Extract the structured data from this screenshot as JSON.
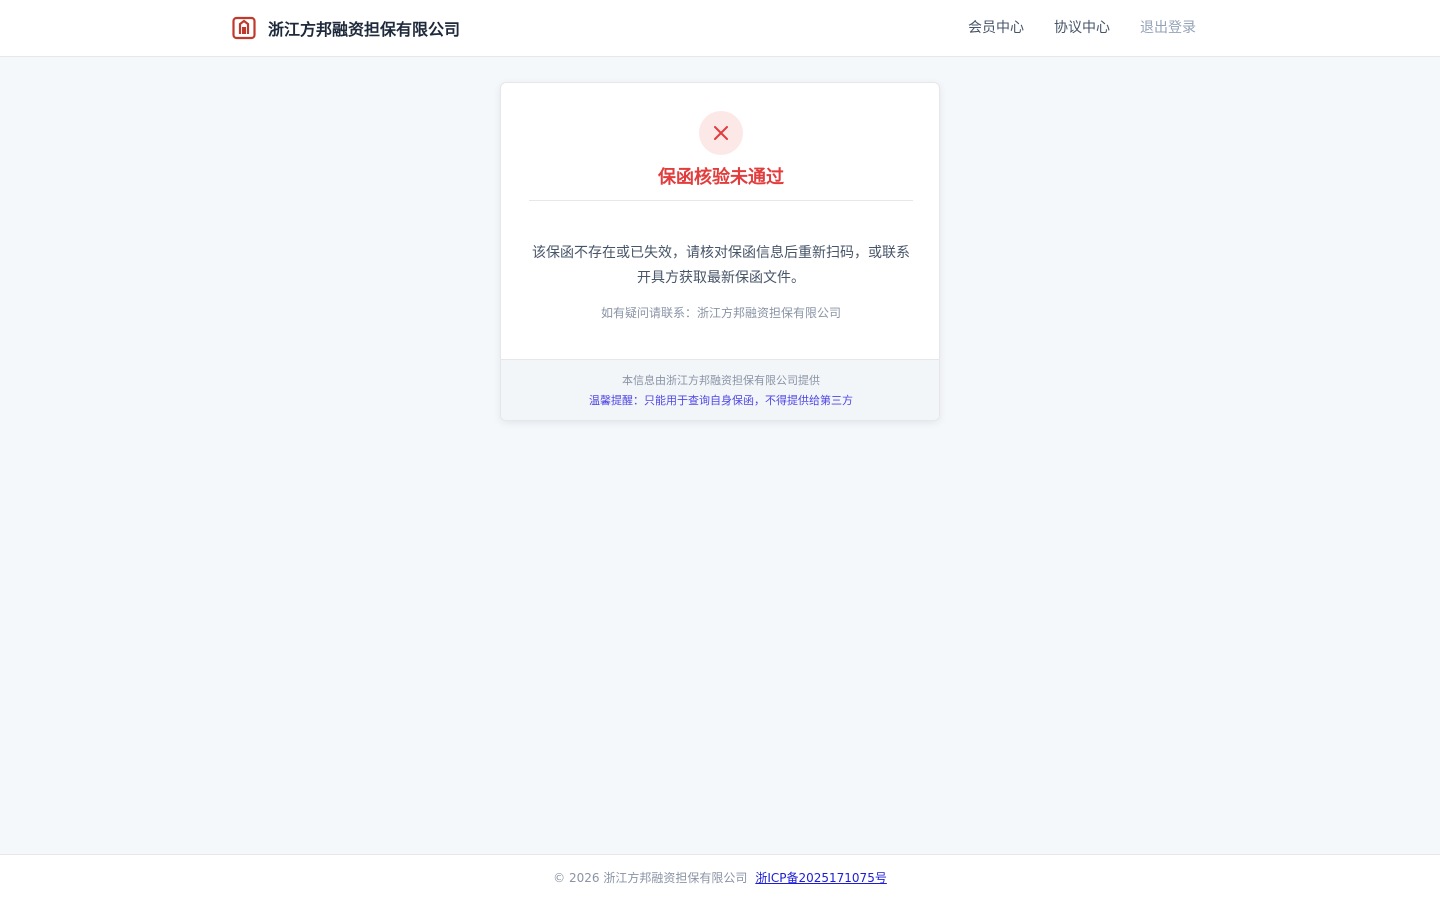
{
  "header": {
    "company_name": "浙江方邦融资担保有限公司",
    "logo_icon": "gate-logo-icon",
    "nav": {
      "member_center": "会员中心",
      "agreement_center": "协议中心",
      "logout": "退出登录"
    }
  },
  "result_card": {
    "status_icon": "close-icon",
    "title": "保函核验未通过",
    "message": "该保函不存在或已失效，请核对保函信息后重新扫码，或联系开具方获取最新保函文件。",
    "contact": "如有疑问请联系：浙江方邦融资担保有限公司",
    "provider_note": "本信息由浙江方邦融资担保有限公司提供",
    "warning_note": "温馨提醒：只能用于查询自身保函，不得提供给第三方"
  },
  "footer": {
    "copyright": "© 2026 浙江方邦融资担保有限公司",
    "icp": "浙ICP备2025171075号"
  },
  "colors": {
    "accent_error": "#e23c3c",
    "error_bg": "#fde8e8",
    "warning_text": "#4f46e5",
    "page_bg": "#f5f8fb"
  }
}
